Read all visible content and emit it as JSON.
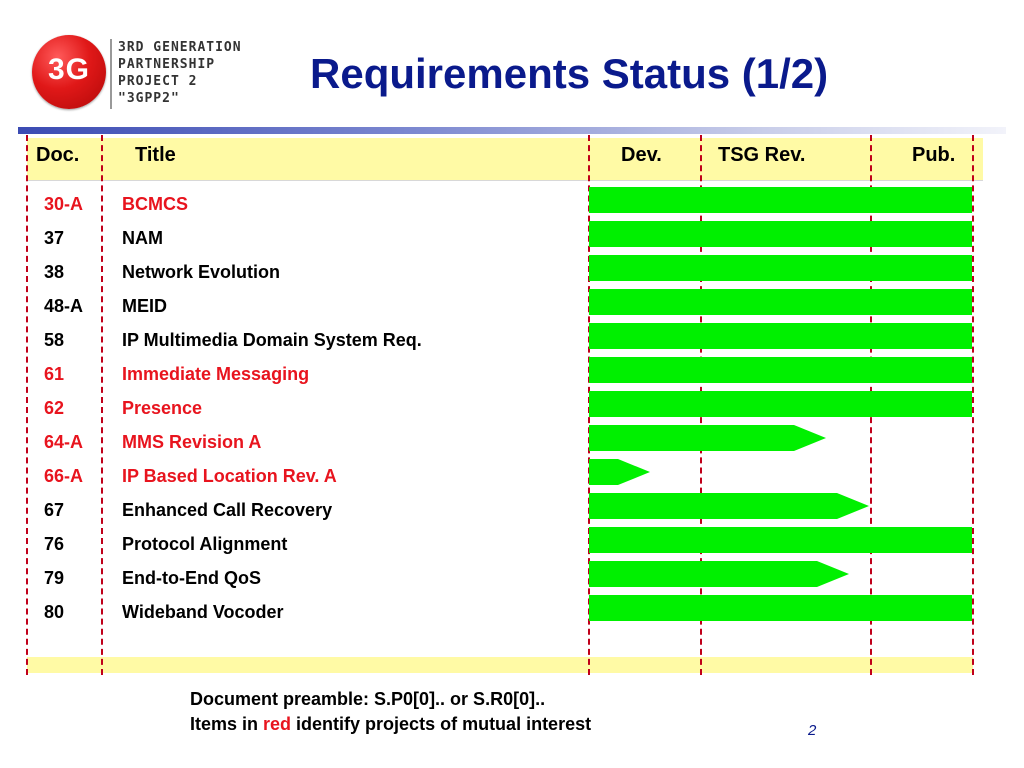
{
  "logo": {
    "mark": "3G",
    "lines": [
      "3RD GENERATION",
      "PARTNERSHIP",
      "PROJECT 2",
      "\"3GPP2\""
    ]
  },
  "title": "Requirements Status (1/2)",
  "columns": {
    "doc": "Doc.",
    "title": "Title",
    "dev": "Dev.",
    "tsg": "TSG Rev.",
    "pub": "Pub."
  },
  "rows": [
    {
      "doc": "30-A",
      "title": "BCMCS",
      "red": true,
      "progress": 1.0
    },
    {
      "doc": "37",
      "title": "NAM",
      "red": false,
      "progress": 1.0
    },
    {
      "doc": "38",
      "title": "Network Evolution",
      "red": false,
      "progress": 1.0
    },
    {
      "doc": "48-A",
      "title": "MEID",
      "red": false,
      "progress": 1.0
    },
    {
      "doc": "58",
      "title": "IP Multimedia Domain System Req.",
      "red": false,
      "progress": 1.0
    },
    {
      "doc": "61",
      "title": "Immediate Messaging",
      "red": true,
      "progress": 1.0
    },
    {
      "doc": "62",
      "title": "Presence",
      "red": true,
      "progress": 1.0
    },
    {
      "doc": "64-A",
      "title": "MMS Revision A",
      "red": true,
      "progress": 0.62
    },
    {
      "doc": "66-A",
      "title": "IP Based Location Rev. A",
      "red": true,
      "progress": 0.16
    },
    {
      "doc": "67",
      "title": "Enhanced Call Recovery",
      "red": false,
      "progress": 0.73
    },
    {
      "doc": "76",
      "title": "Protocol Alignment",
      "red": false,
      "progress": 1.0
    },
    {
      "doc": "79",
      "title": "End-to-End QoS",
      "red": false,
      "progress": 0.68
    },
    {
      "doc": "80",
      "title": "Wideband Vocoder",
      "red": false,
      "progress": 1.0
    }
  ],
  "notes": {
    "line1": "Document preamble:  S.P0[0].. or S.R0[0]..",
    "line2_prefix": "Items in ",
    "line2_red": "red",
    "line2_suffix": " identify projects of mutual interest"
  },
  "page_number": "2",
  "colors": {
    "title": "#0a1a8c",
    "highlight": "#fffaa5",
    "bar": "#00f000",
    "mutual_interest": "#e8141e"
  }
}
